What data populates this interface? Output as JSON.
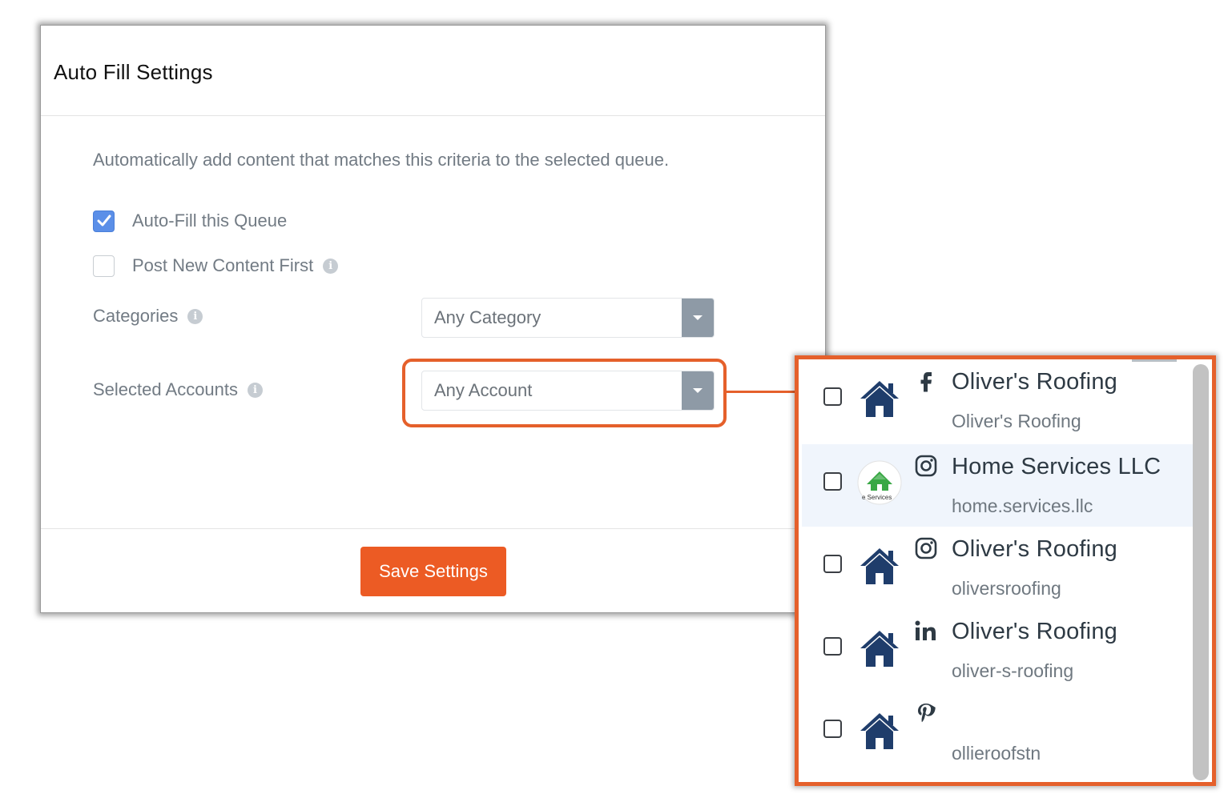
{
  "modal": {
    "title": "Auto Fill Settings",
    "intro": "Automatically add content that matches this criteria to the selected queue.",
    "options": [
      {
        "label": "Auto-Fill this Queue",
        "checked": true
      },
      {
        "label": "Post New Content First",
        "checked": false
      }
    ],
    "categories": {
      "label": "Categories",
      "value": "Any Category"
    },
    "accounts": {
      "label": "Selected Accounts",
      "value": "Any Account"
    },
    "save_label": "Save Settings"
  },
  "dropdown": {
    "accounts": [
      {
        "network": "facebook-icon",
        "avatar": "house-logo",
        "name": "Oliver's Roofing",
        "handle": "Oliver's Roofing",
        "checked": false
      },
      {
        "network": "instagram-icon",
        "avatar": "home-services-logo",
        "avatar_text": "e Services",
        "name": "Home Services LLC",
        "handle": "home.services.llc",
        "checked": false
      },
      {
        "network": "instagram-icon",
        "avatar": "house-logo",
        "name": "Oliver's Roofing",
        "handle": "oliversroofing",
        "checked": false
      },
      {
        "network": "linkedin-icon",
        "avatar": "house-logo",
        "name": "Oliver's Roofing",
        "handle": "oliver-s-roofing",
        "checked": false
      },
      {
        "network": "pinterest-icon",
        "avatar": "house-logo",
        "name": "",
        "handle": "ollieroofstn",
        "checked": false
      }
    ]
  },
  "colors": {
    "accent": "#ec5b24",
    "checkbox_checked": "#5b8fe8",
    "select_caret": "#8e9aa6",
    "house_logo": "#1f3d6b"
  }
}
